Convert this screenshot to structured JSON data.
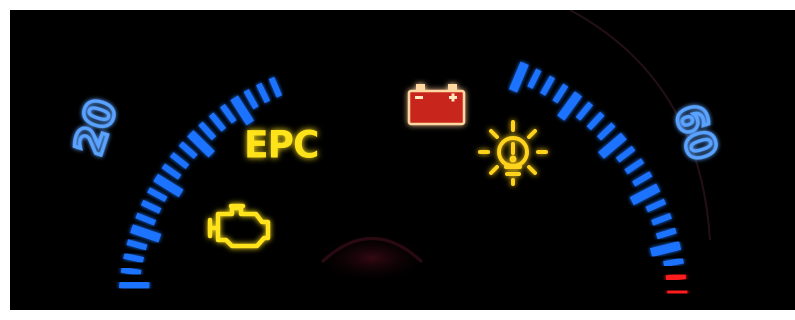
{
  "speedometer": {
    "left_number": "20",
    "right_number": "60",
    "tick_color": "#1e73ff",
    "tick_glow": "#5aa2ff",
    "redline_color": "#ff1a1a"
  },
  "warning_lights": {
    "epc": {
      "label": "EPC",
      "color": "#ffe31a"
    },
    "battery": {
      "icon": "battery-warning-icon",
      "color": "#e0302a",
      "outline": "#ffd7a0"
    },
    "bulb": {
      "icon": "bulb-failure-warning-icon",
      "color": "#ffd21a"
    },
    "engine": {
      "icon": "check-engine-icon",
      "color": "#ffe31a"
    }
  },
  "colors": {
    "background": "#000000",
    "page": "#ffffff"
  }
}
